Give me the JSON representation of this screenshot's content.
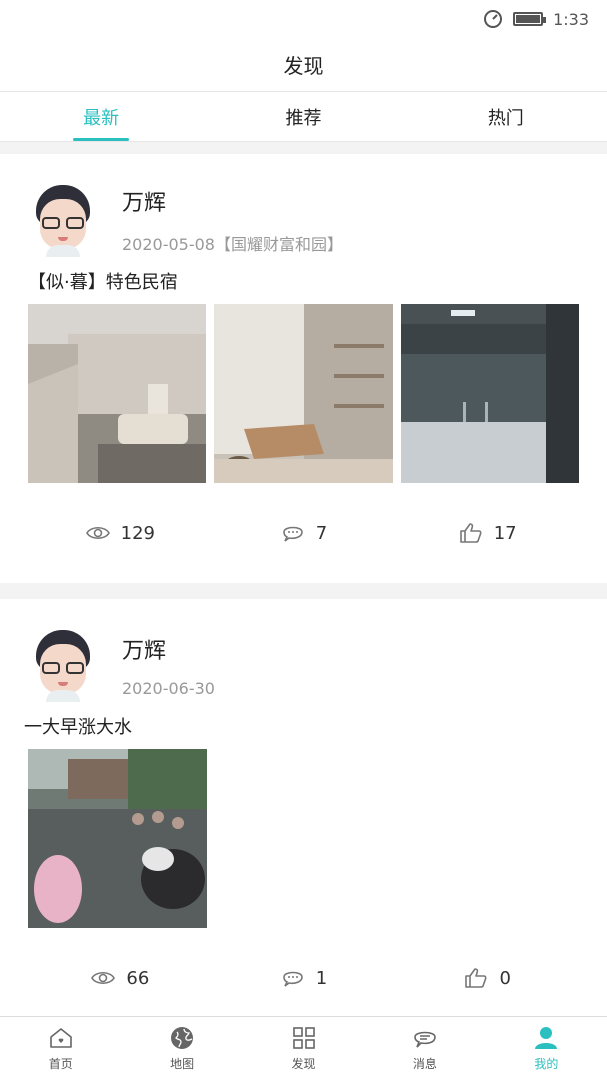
{
  "status": {
    "time": "1:33"
  },
  "header": {
    "title": "发现"
  },
  "tabs": [
    {
      "label": "最新",
      "active": true
    },
    {
      "label": "推荐",
      "active": false
    },
    {
      "label": "热门",
      "active": false
    }
  ],
  "posts": [
    {
      "author": "万辉",
      "date": "2020-05-08【国耀财富和园】",
      "text": "【似·暮】特色民宿",
      "views": "129",
      "comments": "7",
      "likes": "17"
    },
    {
      "author": "万辉",
      "date": "2020-06-30",
      "text": "一大早涨大水",
      "views": "66",
      "comments": "1",
      "likes": "0"
    }
  ],
  "nav": [
    {
      "label": "首页",
      "icon": "home-icon"
    },
    {
      "label": "地图",
      "icon": "globe-icon"
    },
    {
      "label": "发现",
      "icon": "grid-icon"
    },
    {
      "label": "消息",
      "icon": "message-icon"
    },
    {
      "label": "我的",
      "icon": "user-icon",
      "active": true
    }
  ],
  "colors": {
    "accent": "#2bbfbf"
  }
}
